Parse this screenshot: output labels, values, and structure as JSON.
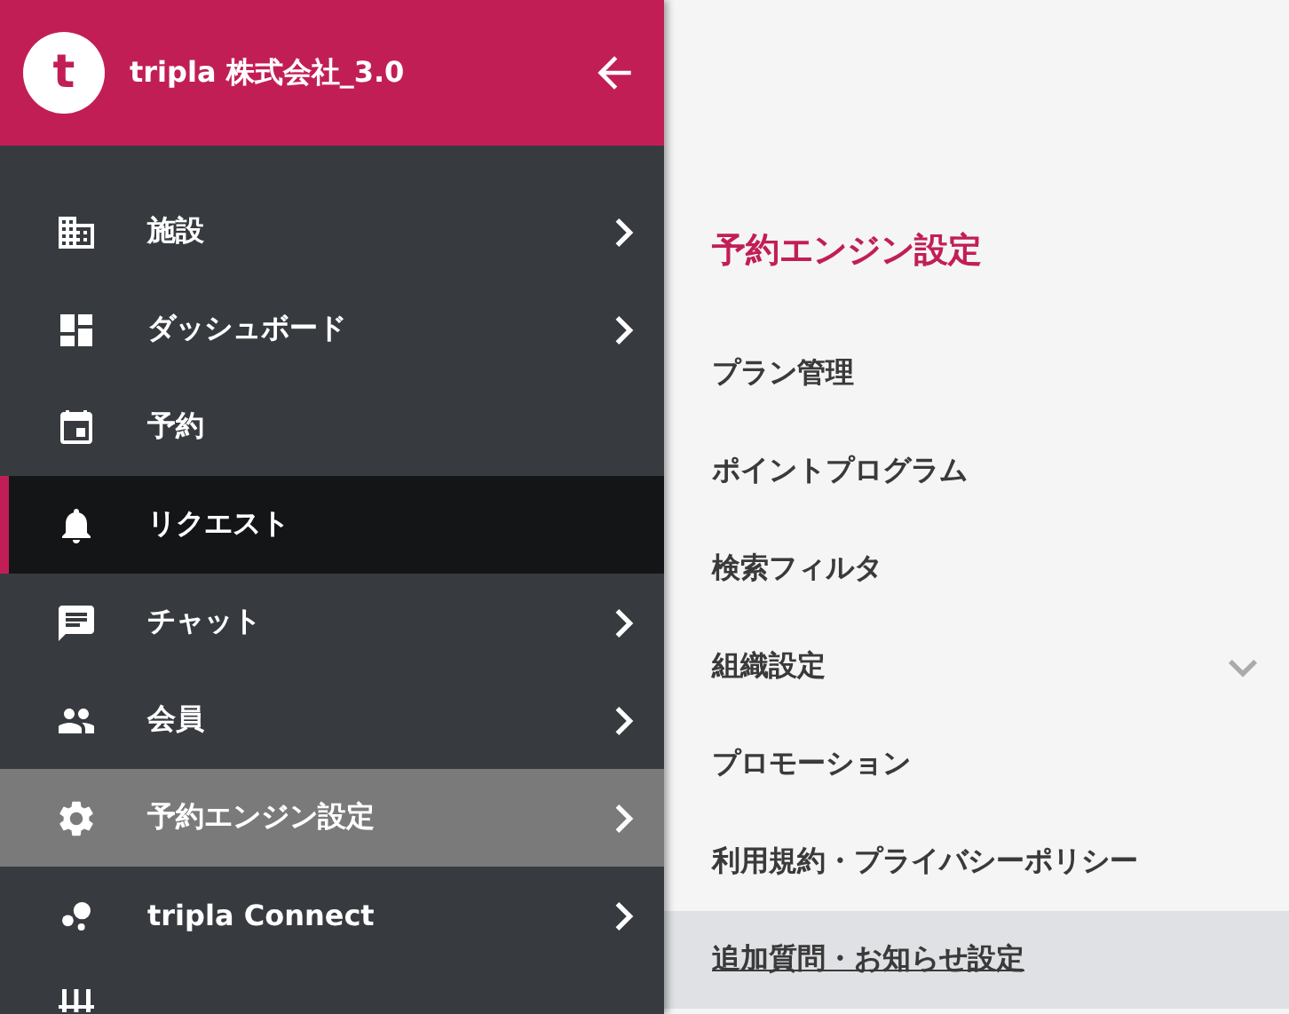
{
  "header": {
    "avatar_letter": "t",
    "company": "tripla 株式会社_3.0"
  },
  "sidebar": {
    "items": [
      {
        "label": "施設",
        "expandable": true,
        "selected": false,
        "open": false
      },
      {
        "label": "ダッシュボード",
        "expandable": true,
        "selected": false,
        "open": false
      },
      {
        "label": "予約",
        "expandable": false,
        "selected": false,
        "open": false
      },
      {
        "label": "リクエスト",
        "expandable": false,
        "selected": true,
        "open": false
      },
      {
        "label": "チャット",
        "expandable": true,
        "selected": false,
        "open": false
      },
      {
        "label": "会員",
        "expandable": true,
        "selected": false,
        "open": false
      },
      {
        "label": "予約エンジン設定",
        "expandable": true,
        "selected": false,
        "open": true
      },
      {
        "label": "tripla Connect",
        "expandable": true,
        "selected": false,
        "open": false
      },
      {
        "expandable": false,
        "selected": false,
        "open": false
      }
    ]
  },
  "submenu": {
    "title": "予約エンジン設定",
    "items": [
      {
        "label": "プラン管理",
        "expandable": false,
        "selected": false
      },
      {
        "label": "ポイントプログラム",
        "expandable": false,
        "selected": false
      },
      {
        "label": "検索フィルタ",
        "expandable": false,
        "selected": false
      },
      {
        "label": "組織設定",
        "expandable": true,
        "selected": false
      },
      {
        "label": "プロモーション",
        "expandable": false,
        "selected": false
      },
      {
        "label": "利用規約・プライバシーポリシー",
        "expandable": false,
        "selected": false
      },
      {
        "label": "追加質問・お知らせ設定",
        "expandable": false,
        "selected": true
      }
    ]
  }
}
